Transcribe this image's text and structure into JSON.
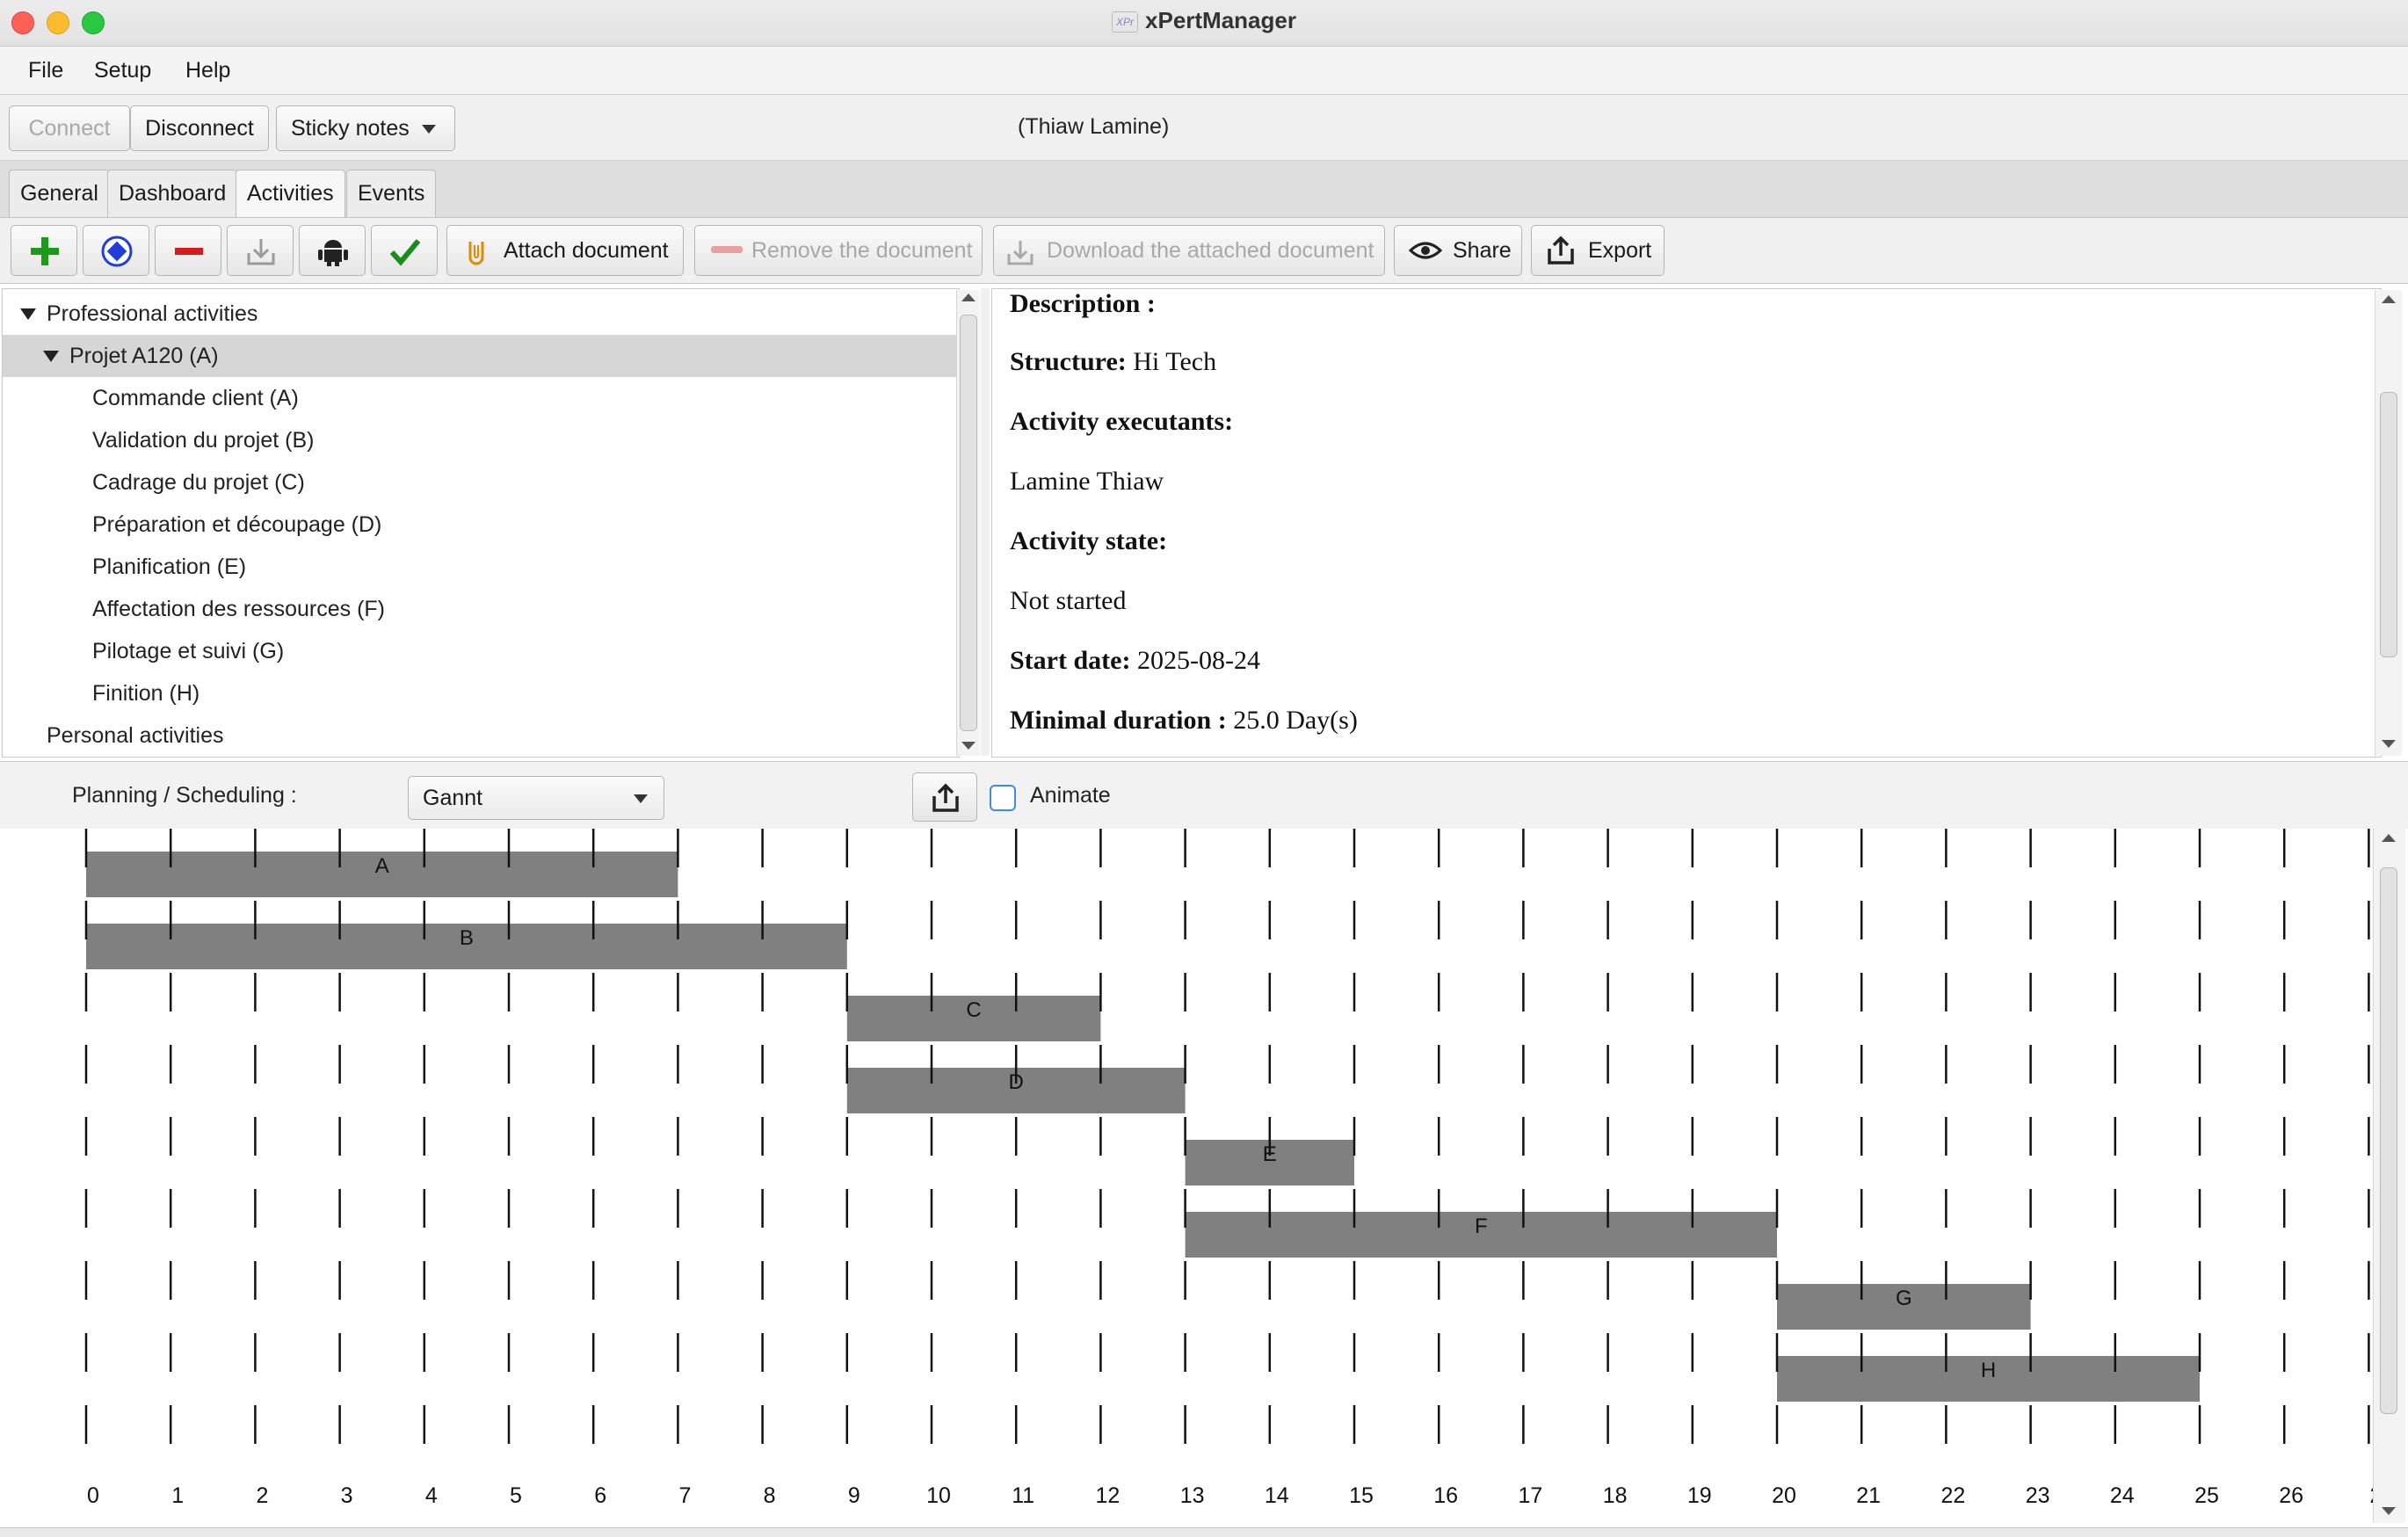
{
  "window": {
    "title": "xPertManager",
    "logo_text": "XPr"
  },
  "menu": {
    "items": [
      "File",
      "Setup",
      "Help"
    ]
  },
  "connection": {
    "connect_label": "Connect",
    "disconnect_label": "Disconnect",
    "sticky_notes_label": "Sticky notes",
    "user": "(Thiaw Lamine)"
  },
  "tabs": [
    {
      "label": "General",
      "active": false
    },
    {
      "label": "Dashboard",
      "active": false
    },
    {
      "label": "Activities",
      "active": true
    },
    {
      "label": "Events",
      "active": false
    }
  ],
  "toolbar": {
    "icon_buttons": [
      "add-icon",
      "target-icon",
      "remove-icon",
      "download-icon",
      "android-icon",
      "check-icon"
    ],
    "attach_label": "Attach document",
    "remove_doc_label": "Remove the document",
    "download_doc_label": "Download the attached document",
    "share_label": "Share",
    "export_label": "Export"
  },
  "tree": {
    "root1": "Professional activities",
    "project": "Projet A120 (A)",
    "items": [
      "Commande client (A)",
      "Validation du projet (B)",
      "Cadrage du projet (C)",
      "Préparation et découpage (D)",
      "Planification (E)",
      "Affectation des ressources (F)",
      "Pilotage et suivi (G)",
      "Finition (H)"
    ],
    "root2": "Personal activities"
  },
  "detail": {
    "description_label": "Description :",
    "structure_label": "Structure:",
    "structure_value": "Hi Tech",
    "executants_label": "Activity executants:",
    "executant": "Lamine Thiaw",
    "state_label": "Activity state:",
    "state_value": "Not started",
    "start_label": "Start date:",
    "start_value": "2025-08-24",
    "duration_label": "Minimal duration :",
    "duration_value": "25.0 Day(s)"
  },
  "planning": {
    "label": "Planning / Scheduling :",
    "mode": "Gannt",
    "animate_label": "Animate",
    "animate_checked": false
  },
  "chart_data": {
    "type": "gantt",
    "x_ticks": [
      "0",
      "1",
      "2",
      "3",
      "4",
      "5",
      "6",
      "7",
      "8",
      "9",
      "10",
      "11",
      "12",
      "13",
      "14",
      "15",
      "16",
      "17",
      "18",
      "19",
      "20",
      "21",
      "22",
      "23",
      "24",
      "25",
      "26",
      "2"
    ],
    "tasks": [
      {
        "name": "A",
        "start": 0,
        "end": 7
      },
      {
        "name": "B",
        "start": 0,
        "end": 9
      },
      {
        "name": "C",
        "start": 9,
        "end": 12
      },
      {
        "name": "D",
        "start": 9,
        "end": 13
      },
      {
        "name": "E",
        "start": 13,
        "end": 15
      },
      {
        "name": "F",
        "start": 13,
        "end": 20
      },
      {
        "name": "G",
        "start": 20,
        "end": 23
      },
      {
        "name": "H",
        "start": 20,
        "end": 25
      }
    ],
    "bar_color": "#808080"
  }
}
